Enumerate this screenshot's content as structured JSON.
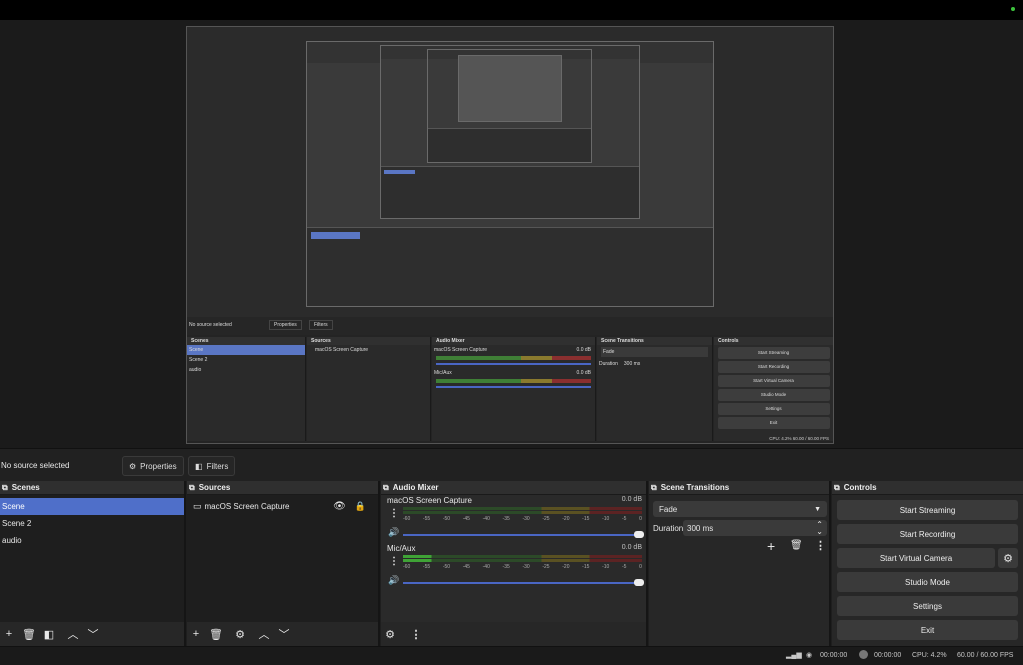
{
  "preview": {
    "inner_status": "No source selected",
    "inner_properties": "Properties",
    "inner_filters": "Filters",
    "inner_scenes_title": "Scenes",
    "inner_sources_title": "Sources",
    "inner_mixer_title": "Audio Mixer",
    "inner_transitions_title": "Scene Transitions",
    "inner_controls_title": "Controls",
    "inner_scenes": [
      "Scene",
      "Scene 2",
      "audio"
    ],
    "inner_source": "macOS Screen Capture",
    "inner_mixer": [
      {
        "name": "macOS Screen Capture",
        "db": "0.0 dB"
      },
      {
        "name": "Mic/Aux",
        "db": "0.0 dB"
      }
    ],
    "inner_transition": "Fade",
    "inner_duration_label": "Duration",
    "inner_duration": "300 ms",
    "inner_controls": [
      "Start Streaming",
      "Start Recording",
      "Start Virtual Camera",
      "Studio Mode",
      "Settings",
      "Exit"
    ],
    "inner_status_right": "CPU: 4.2%    60.00 / 60.00 FPS"
  },
  "source_bar": {
    "label": "No source selected",
    "properties": "Properties",
    "filters": "Filters"
  },
  "scenes": {
    "title": "Scenes",
    "items": [
      "Scene",
      "Scene 2",
      "audio"
    ]
  },
  "sources": {
    "title": "Sources",
    "items": [
      "macOS Screen Capture"
    ]
  },
  "mixer": {
    "title": "Audio Mixer",
    "channels": [
      {
        "name": "macOS Screen Capture",
        "db": "0.0 dB",
        "volume": 1.0
      },
      {
        "name": "Mic/Aux",
        "db": "0.0 dB",
        "volume": 1.0
      }
    ],
    "scale": [
      "-60",
      "-55",
      "-50",
      "-45",
      "-40",
      "-35",
      "-30",
      "-25",
      "-20",
      "-15",
      "-10",
      "-5",
      "0"
    ]
  },
  "transitions": {
    "title": "Scene Transitions",
    "selected": "Fade",
    "duration_label": "Duration",
    "duration_value": "300 ms"
  },
  "controls": {
    "title": "Controls",
    "start_streaming": "Start Streaming",
    "start_recording": "Start Recording",
    "start_virtual_camera": "Start Virtual Camera",
    "studio_mode": "Studio Mode",
    "settings": "Settings",
    "exit": "Exit"
  },
  "status": {
    "stream_time": "00:00:00",
    "rec_time": "00:00:00",
    "cpu": "CPU: 4.2%",
    "fps": "60.00 / 60.00 FPS"
  },
  "colors": {
    "selection": "#4f6fc9",
    "meter_green": "#3fa336",
    "meter_yellow": "#b2a02e",
    "meter_red": "#b03030",
    "online_dot": "#3cc23c"
  }
}
